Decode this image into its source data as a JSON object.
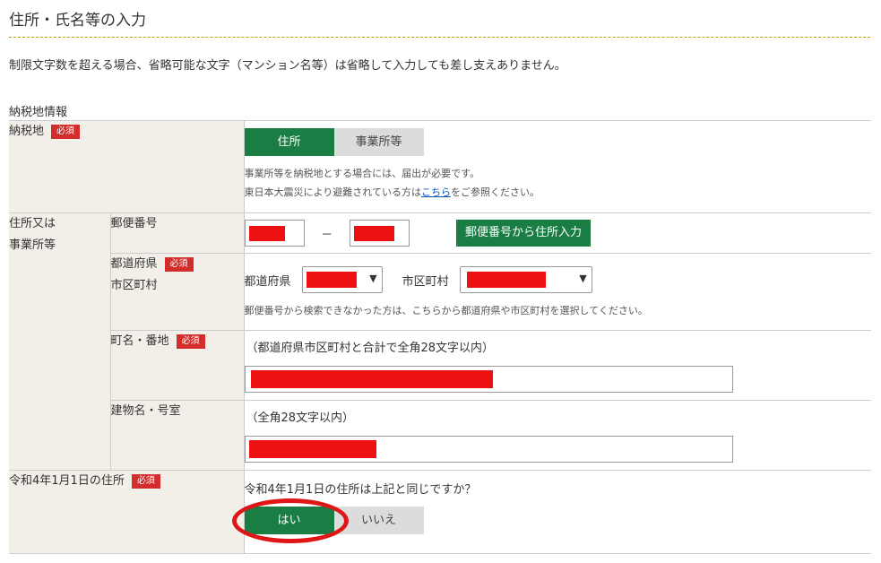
{
  "page": {
    "title": "住所・氏名等の入力",
    "intro": "制限文字数を超える場合、省略可能な文字（マンション名等）は省略して入力しても差し支えありません。",
    "section_label": "納税地情報",
    "required_badge": "必須"
  },
  "tax_place": {
    "label": "納税地",
    "options": [
      "住所",
      "事業所等"
    ],
    "selected": "住所",
    "note1": "事業所等を納税地とする場合には、届出が必要です。",
    "note2_prefix": "東日本大震災により避難されている方は",
    "note2_link": "こちら",
    "note2_suffix": "をご参照ください。"
  },
  "address": {
    "group_label_1": "住所又は",
    "group_label_2": "事業所等",
    "postal_label": "郵便番号",
    "postal_sep": "－",
    "postal_button": "郵便番号から住所入力",
    "pref_city_label_1": "都道府県",
    "pref_city_label_2": "市区町村",
    "pref_label": "都道府県",
    "city_label": "市区町村",
    "pref_city_note": "郵便番号から検索できなかった方は、こちらから都道府県や市区町村を選択してください。",
    "town_label": "町名・番地",
    "town_hint": "（都道府県市区町村と合計で全角28文字以内）",
    "building_label": "建物名・号室",
    "building_hint": "（全角28文字以内）"
  },
  "reiwa": {
    "label": "令和4年1月1日の住所",
    "question": "令和4年1月1日の住所は上記と同じですか？",
    "yes": "はい",
    "no": "いいえ",
    "selected": "はい"
  },
  "colors": {
    "accent_green": "#1a7e44",
    "badge_red": "#d42b2b",
    "redaction": "#ee1111",
    "label_bg": "#f1efe7"
  }
}
